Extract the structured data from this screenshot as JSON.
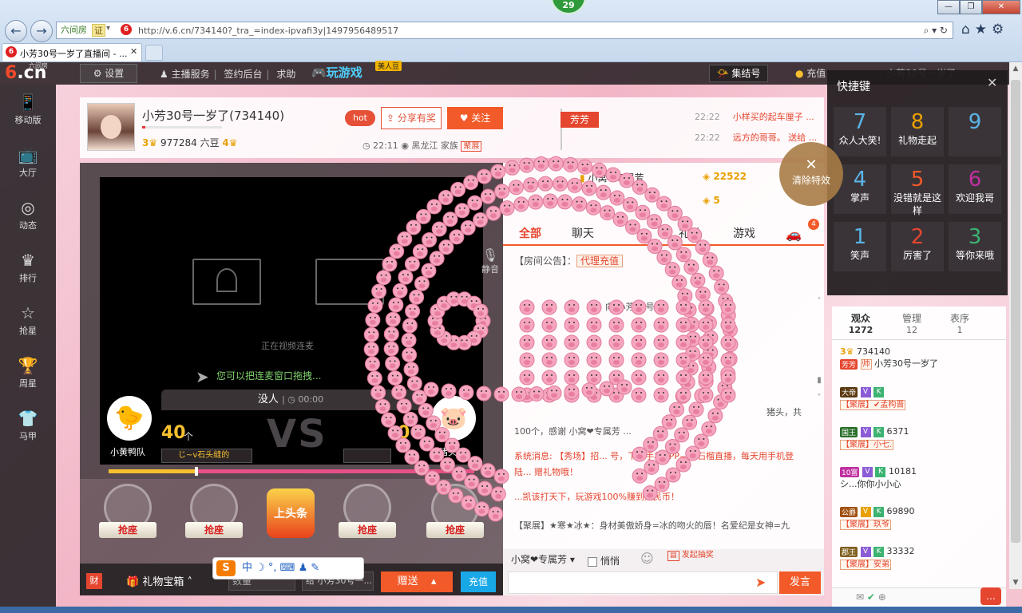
{
  "browser": {
    "badge": "29",
    "address": {
      "site_tag": "六间房",
      "cert_tag": "证",
      "url": "http://v.6.cn/734140?_tra_=index-ipvafi3y|1497956489517"
    },
    "tab": {
      "logo": "6",
      "title": "小芳30号一岁了直播间 - ...",
      "close": "✕"
    },
    "window_controls": {
      "min": "—",
      "max": "❐",
      "close": "✕"
    },
    "toolbar_icons": "⌂★⚙"
  },
  "topbar": {
    "logo": "6.cn",
    "logo_small": "六间房",
    "settings_label": "设置",
    "nav": [
      "主播服务",
      "签约后台",
      "求助"
    ],
    "play_game": "玩游戏",
    "play_badge": "美人豆",
    "gather": "集结号",
    "charge": "充值",
    "user": "小芳30号一岁了"
  },
  "leftnav": [
    {
      "label": "移动版",
      "icon": "mobile-icon"
    },
    {
      "label": "大厅",
      "icon": "tv-icon"
    },
    {
      "label": "动态",
      "icon": "compass-icon"
    },
    {
      "label": "排行",
      "icon": "crown-icon"
    },
    {
      "label": "抢星",
      "icon": "star-icon"
    },
    {
      "label": "周星",
      "icon": "trophy-icon"
    },
    {
      "label": "马甲",
      "icon": "shirt-icon"
    }
  ],
  "room": {
    "title": "小芳30号一岁了(734140)",
    "level_left": "3",
    "beans": "977284 六豆",
    "level_right": "4",
    "hot": "hot",
    "share": "分享有奖",
    "follow": "关注",
    "time": "22:11",
    "location": "黑龙江",
    "family_label": "家族",
    "family": "聚展",
    "flag": "芳芳"
  },
  "news": [
    {
      "time": "22:22",
      "text": "小样买的起车厘子 ..."
    },
    {
      "time": "22:22",
      "text": "远方的哥哥。 送给 ..."
    }
  ],
  "video": {
    "mute": "静音",
    "connecting": "正在视频连麦",
    "drag_hint": "您可以把连麦窗口拖拽..."
  },
  "pk": {
    "nobody": "没人",
    "time": "00:00",
    "left_team": "小黄鸭队",
    "right_team": "猪头队",
    "left_score": "40",
    "unit": "个",
    "right_score": "0",
    "vs": "VS",
    "left_fan": "じ~v石头缝的",
    "left_share": 0.24
  },
  "seats": [
    "抢座",
    "抢座",
    "抢座",
    "抢座"
  ],
  "headline": "上头条",
  "gift_bar": {
    "cai": "财",
    "gift_box": "礼物宝箱",
    "qty_placeholder": "数量",
    "to_label": "给 小芳30号一...",
    "send": "赠送",
    "recharge": "充值"
  },
  "ime": {
    "logo": "S",
    "text": "中 ☽ °, ⌨ ♟ ✎"
  },
  "chat": {
    "rank": [
      {
        "name": "小窝❤专属芳",
        "value": "22522"
      },
      {
        "name": "",
        "value": "5"
      }
    ],
    "tabs": [
      "全部",
      "聊天",
      "礼单",
      "游戏"
    ],
    "car_count": "4",
    "announce_label": "【房间公告】：",
    "agent": "代理充值",
    "msg1": "向 小芳30号...",
    "msg1b": "100个，感谢 小窝❤专属芳 ...",
    "msg1c": "猪头，共",
    "sys1": "系统消息: 【秀场】招... 号，下载手机APP——石榴直播，每天用手机登陆... 赠礼物哦！",
    "sys2": "...凯该打天下，玩游戏100%赚到人民币！",
    "msg2": "【聚展】★寒★冰★：身材美傲娇身=冰的吻火的唇！名爱纪是女神=九",
    "to_user": "小窝❤专属芳",
    "whisper": "悄悄",
    "lucky": "发起抽奖",
    "speak": "发言"
  },
  "audience": {
    "tabs": [
      {
        "label": "观众",
        "count": "1272"
      },
      {
        "label": "管理",
        "count": "12"
      },
      {
        "label": "表序",
        "count": "1"
      }
    ],
    "list": [
      {
        "badge": "3",
        "id": "734140",
        "tag": "芳芳",
        "tag2": "帅",
        "name": "小芳30号一岁了"
      },
      {
        "badge": "大帝",
        "name": "【聚展】✔孟构晋"
      },
      {
        "badge": "国王",
        "id": "6371",
        "name": "【聚展】小七."
      },
      {
        "badge": "10富",
        "id": "10181",
        "name": "シ...你你小小心"
      },
      {
        "badge": "公爵",
        "id": "69890",
        "name": "【聚展】玖爷"
      },
      {
        "badge": "郡王",
        "id": "33332",
        "name": "【聚展】安弟"
      }
    ]
  },
  "shortcuts": {
    "title": "快捷键",
    "clear": "清除特效",
    "items": [
      {
        "num": "7",
        "label": "众人大笑!"
      },
      {
        "num": "8",
        "label": "礼物走起"
      },
      {
        "num": "9",
        "label": ""
      },
      {
        "num": "4",
        "label": "掌声"
      },
      {
        "num": "5",
        "label": "没错就是这样"
      },
      {
        "num": "6",
        "label": "欢迎我哥"
      },
      {
        "num": "1",
        "label": "笑声"
      },
      {
        "num": "2",
        "label": "厉害了"
      },
      {
        "num": "3",
        "label": "等你来哦"
      }
    ]
  },
  "colors": {
    "accent": "#f25a29",
    "pig": "#f48fb1",
    "dark": "#2e282b"
  }
}
